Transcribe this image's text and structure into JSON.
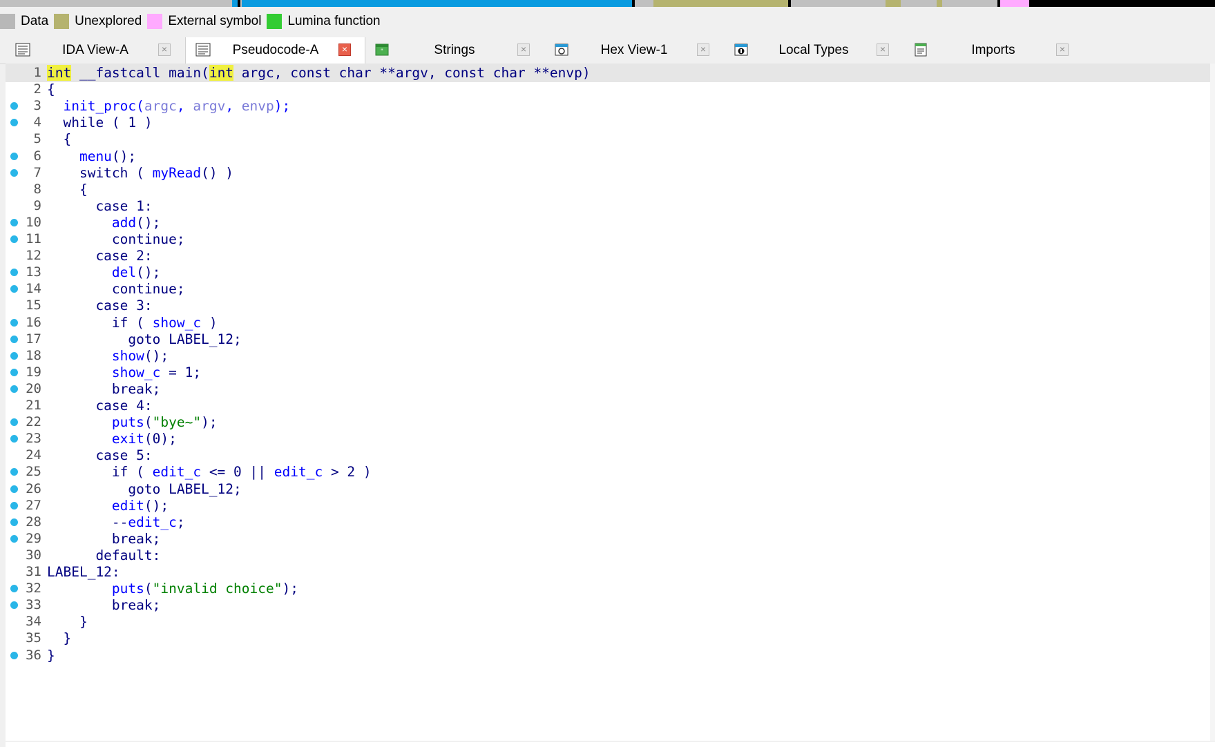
{
  "legend": {
    "items": [
      {
        "label": "Data",
        "color": "#b8b8b8"
      },
      {
        "label": "Unexplored",
        "color": "#b5b36f"
      },
      {
        "label": "External symbol",
        "color": "#ffaaff"
      },
      {
        "label": "Lumina function",
        "color": "#33cc33"
      }
    ]
  },
  "navband": {
    "colors": {
      "code": "#0a9be0",
      "unexplored": "#b5b36f",
      "data": "#c0c0c0",
      "external": "#ffaaff",
      "black": "#000000"
    }
  },
  "tabs": [
    {
      "label": "IDA View-A",
      "icon": "ida-view-icon",
      "active": false
    },
    {
      "label": "Pseudocode-A",
      "icon": "pseudocode-icon",
      "active": true
    },
    {
      "label": "Strings",
      "icon": "strings-icon",
      "active": false
    },
    {
      "label": "Hex View-1",
      "icon": "hex-view-icon",
      "active": false
    },
    {
      "label": "Local Types",
      "icon": "local-types-icon",
      "active": false
    },
    {
      "label": "Imports",
      "icon": "imports-icon",
      "active": false
    }
  ],
  "close_glyph": "×",
  "code": {
    "current_line": 1,
    "lines": [
      {
        "n": "1",
        "dot": false,
        "tokens": [
          [
            "int",
            "hl"
          ],
          [
            " __fastcall main(",
            "k"
          ],
          [
            "int",
            "hl"
          ],
          [
            " argc, const char **argv, const char **envp)",
            "k"
          ]
        ]
      },
      {
        "n": "2",
        "dot": false,
        "tokens": [
          [
            "{",
            "k"
          ]
        ]
      },
      {
        "n": "3",
        "dot": true,
        "tokens": [
          [
            "  init_proc(",
            "f"
          ],
          [
            "argc",
            "v"
          ],
          [
            ", ",
            "f"
          ],
          [
            "argv",
            "v"
          ],
          [
            ", ",
            "f"
          ],
          [
            "envp",
            "v"
          ],
          [
            ");",
            "f"
          ]
        ]
      },
      {
        "n": "4",
        "dot": true,
        "tokens": [
          [
            "  while ( 1 )",
            "k"
          ]
        ]
      },
      {
        "n": "5",
        "dot": false,
        "tokens": [
          [
            "  {",
            "k"
          ]
        ]
      },
      {
        "n": "6",
        "dot": true,
        "tokens": [
          [
            "    menu",
            "f"
          ],
          [
            "();",
            "k"
          ]
        ]
      },
      {
        "n": "7",
        "dot": true,
        "tokens": [
          [
            "    switch ( ",
            "k"
          ],
          [
            "myRead",
            "f"
          ],
          [
            "() )",
            "k"
          ]
        ]
      },
      {
        "n": "8",
        "dot": false,
        "tokens": [
          [
            "    {",
            "k"
          ]
        ]
      },
      {
        "n": "9",
        "dot": false,
        "tokens": [
          [
            "      case 1:",
            "k"
          ]
        ]
      },
      {
        "n": "10",
        "dot": true,
        "tokens": [
          [
            "        add",
            "f"
          ],
          [
            "();",
            "k"
          ]
        ]
      },
      {
        "n": "11",
        "dot": true,
        "tokens": [
          [
            "        continue;",
            "k"
          ]
        ]
      },
      {
        "n": "12",
        "dot": false,
        "tokens": [
          [
            "      case 2:",
            "k"
          ]
        ]
      },
      {
        "n": "13",
        "dot": true,
        "tokens": [
          [
            "        del",
            "f"
          ],
          [
            "();",
            "k"
          ]
        ]
      },
      {
        "n": "14",
        "dot": true,
        "tokens": [
          [
            "        continue;",
            "k"
          ]
        ]
      },
      {
        "n": "15",
        "dot": false,
        "tokens": [
          [
            "      case 3:",
            "k"
          ]
        ]
      },
      {
        "n": "16",
        "dot": true,
        "tokens": [
          [
            "        if ( ",
            "k"
          ],
          [
            "show_c",
            "f"
          ],
          [
            " )",
            "k"
          ]
        ]
      },
      {
        "n": "17",
        "dot": true,
        "tokens": [
          [
            "          goto LABEL_12;",
            "k"
          ]
        ]
      },
      {
        "n": "18",
        "dot": true,
        "tokens": [
          [
            "        show",
            "f"
          ],
          [
            "();",
            "k"
          ]
        ]
      },
      {
        "n": "19",
        "dot": true,
        "tokens": [
          [
            "        show_c",
            "f"
          ],
          [
            " = 1;",
            "k"
          ]
        ]
      },
      {
        "n": "20",
        "dot": true,
        "tokens": [
          [
            "        break;",
            "k"
          ]
        ]
      },
      {
        "n": "21",
        "dot": false,
        "tokens": [
          [
            "      case 4:",
            "k"
          ]
        ]
      },
      {
        "n": "22",
        "dot": true,
        "tokens": [
          [
            "        puts",
            "f"
          ],
          [
            "(",
            "k"
          ],
          [
            "\"bye~\"",
            "s"
          ],
          [
            ");",
            "k"
          ]
        ]
      },
      {
        "n": "23",
        "dot": true,
        "tokens": [
          [
            "        exit",
            "f"
          ],
          [
            "(0);",
            "k"
          ]
        ]
      },
      {
        "n": "24",
        "dot": false,
        "tokens": [
          [
            "      case 5:",
            "k"
          ]
        ]
      },
      {
        "n": "25",
        "dot": true,
        "tokens": [
          [
            "        if ( ",
            "k"
          ],
          [
            "edit_c",
            "f"
          ],
          [
            " <= 0 || ",
            "k"
          ],
          [
            "edit_c",
            "f"
          ],
          [
            " > 2 )",
            "k"
          ]
        ]
      },
      {
        "n": "26",
        "dot": true,
        "tokens": [
          [
            "          goto LABEL_12;",
            "k"
          ]
        ]
      },
      {
        "n": "27",
        "dot": true,
        "tokens": [
          [
            "        edit",
            "f"
          ],
          [
            "();",
            "k"
          ]
        ]
      },
      {
        "n": "28",
        "dot": true,
        "tokens": [
          [
            "        --",
            "k"
          ],
          [
            "edit_c",
            "f"
          ],
          [
            ";",
            "k"
          ]
        ]
      },
      {
        "n": "29",
        "dot": true,
        "tokens": [
          [
            "        break;",
            "k"
          ]
        ]
      },
      {
        "n": "30",
        "dot": false,
        "tokens": [
          [
            "      default:",
            "k"
          ]
        ]
      },
      {
        "n": "31",
        "dot": false,
        "tokens": [
          [
            "LABEL_12:",
            "k"
          ]
        ]
      },
      {
        "n": "32",
        "dot": true,
        "tokens": [
          [
            "        puts",
            "f"
          ],
          [
            "(",
            "k"
          ],
          [
            "\"invalid choice\"",
            "s"
          ],
          [
            ");",
            "k"
          ]
        ]
      },
      {
        "n": "33",
        "dot": true,
        "tokens": [
          [
            "        break;",
            "k"
          ]
        ]
      },
      {
        "n": "34",
        "dot": false,
        "tokens": [
          [
            "    }",
            "k"
          ]
        ]
      },
      {
        "n": "35",
        "dot": false,
        "tokens": [
          [
            "  }",
            "k"
          ]
        ]
      },
      {
        "n": "36",
        "dot": true,
        "tokens": [
          [
            "}",
            "k"
          ]
        ]
      }
    ]
  }
}
